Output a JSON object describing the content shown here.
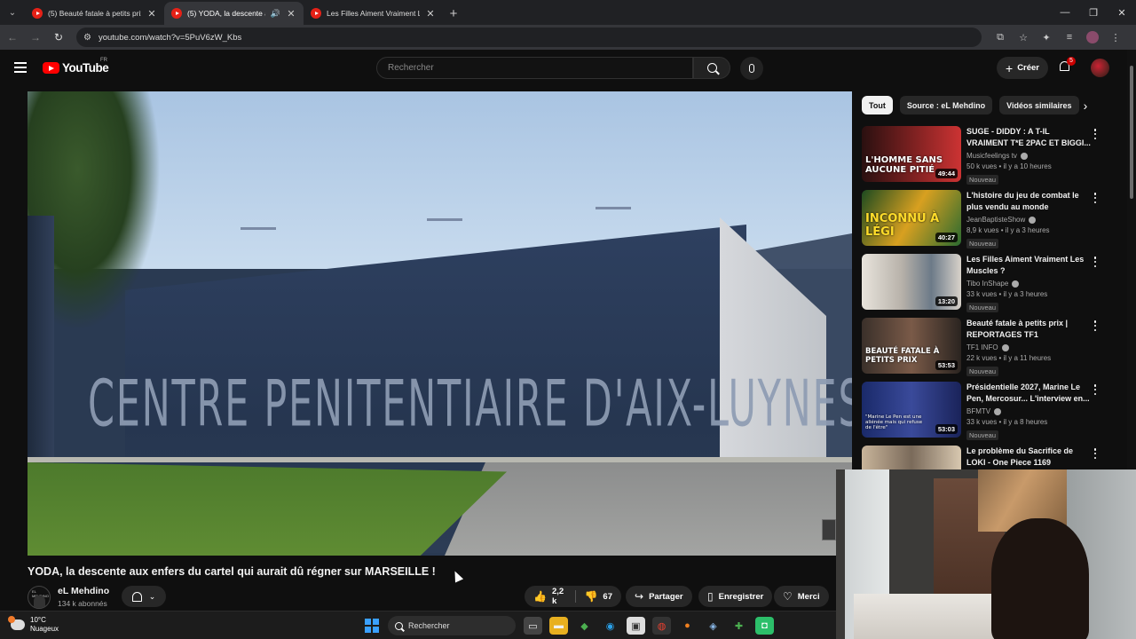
{
  "browser": {
    "tabs": [
      {
        "title": "(5) Beauté fatale à petits prix | …",
        "active": false,
        "audio": false
      },
      {
        "title": "(5) YODA, la descente aux e…",
        "active": true,
        "audio": true
      },
      {
        "title": "Les Filles Aiment Vraiment Les M…",
        "active": false,
        "audio": false
      }
    ],
    "url": "youtube.com/watch?v=5PuV6zW_Kbs"
  },
  "header": {
    "logo_text": "YouTube",
    "country_code": "FR",
    "search_placeholder": "Rechercher",
    "create_label": "Créer",
    "notification_count": "5"
  },
  "video": {
    "frame_text": "CENTRE PENITENTIAIRE D'AIX-LUYNES",
    "title": "YODA, la descente aux enfers du cartel qui aurait dû régner sur MARSEILLE !",
    "channel": {
      "name": "eL Mehdino",
      "subscribers": "134 k abonnés",
      "avatar_text": "EL MEHDINO"
    },
    "actions": {
      "likes": "2,2 k",
      "dislikes": "67",
      "share": "Partager",
      "save": "Enregistrer",
      "thanks": "Merci"
    }
  },
  "sidebar": {
    "chips": [
      "Tout",
      "Source : eL Mehdino",
      "Vidéos similaires"
    ],
    "recommendations": [
      {
        "title": "SUGE - DIDDY : A T-IL VRAIMENT T*E 2PAC ET BIGGI...",
        "channel": "Musicfeelings tv",
        "meta": "50 k vues • il y a 10 heures",
        "badge": "Nouveau",
        "duration": "49:44",
        "thumb_caption": "L'HOMME SANS AUCUNE PITIÉ"
      },
      {
        "title": "L'histoire du jeu de combat le plus vendu au monde",
        "channel": "JeanBaptisteShow",
        "meta": "8,9 k vues • il y a 3 heures",
        "badge": "Nouveau",
        "duration": "40:27",
        "thumb_caption": "INCONNU À LÉGI"
      },
      {
        "title": "Les Filles Aiment Vraiment Les Muscles ?",
        "channel": "Tibo InShape",
        "meta": "33 k vues • il y a 3 heures",
        "badge": "Nouveau",
        "duration": "13:20",
        "thumb_caption": ""
      },
      {
        "title": "Beauté fatale à petits prix | REPORTAGES TF1",
        "channel": "TF1 INFO",
        "meta": "22 k vues • il y a 11 heures",
        "badge": "Nouveau",
        "duration": "53:53",
        "thumb_caption": "BEAUTÉ FATALE À PETITS PRIX"
      },
      {
        "title": "Présidentielle 2027, Marine Le Pen, Mercosur... L'interview en...",
        "channel": "BFMTV",
        "meta": "33 k vues • il y a 8 heures",
        "badge": "Nouveau",
        "duration": "53:03",
        "thumb_caption": "\"Marine Le Pen est une aliénée mais qui refuse de l'être\""
      },
      {
        "title": "Le problème du Sacrifice de LOKI - One Piece 1169",
        "channel": "",
        "meta": "",
        "badge": "",
        "duration": "",
        "thumb_caption": ""
      }
    ]
  },
  "taskbar": {
    "temperature": "10°C",
    "weather": "Nuageux",
    "search_label": "Rechercher"
  },
  "colors": {
    "accent": "#ff0000",
    "background": "#0f0f0f",
    "chip_bg": "#272727"
  }
}
